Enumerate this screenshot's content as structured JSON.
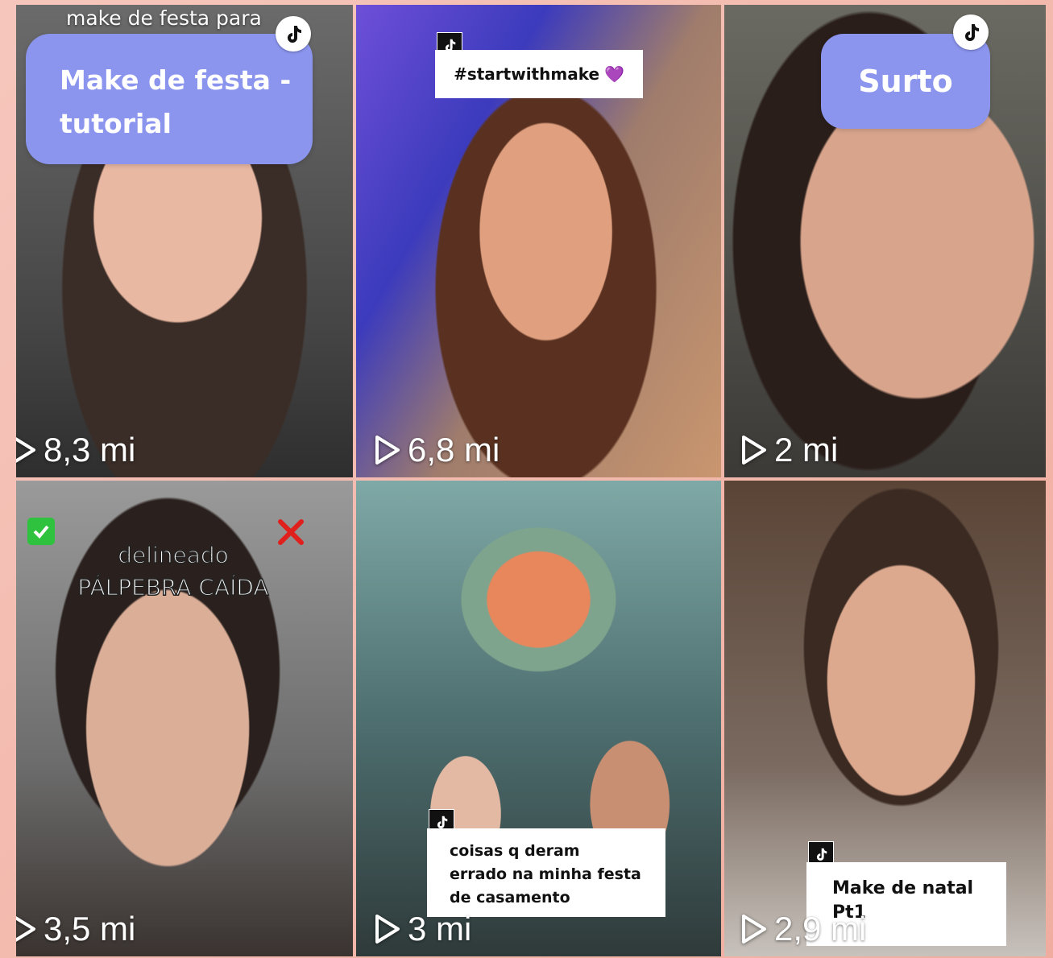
{
  "tiles": [
    {
      "top_caption": "make de festa para",
      "title_lines": [
        "Make de festa -",
        "tutorial"
      ],
      "views": "8,3 mi"
    },
    {
      "hashtag": "#startwithmake",
      "heart_emoji": "💜",
      "views": "6,8 mi"
    },
    {
      "title": "Surto",
      "views": "2 mi"
    },
    {
      "check_emoji": "✅",
      "cross_emoji": "❌",
      "title_lines": [
        "delineado",
        "PÁLPEBRA CAÍDA"
      ],
      "views": "3,5 mi"
    },
    {
      "caption_lines": [
        "coisas q deram",
        "errado na minha festa",
        "de casamento"
      ],
      "views": "3 mi"
    },
    {
      "caption_lines": [
        "Make de natal",
        "Pt1"
      ],
      "views": "2,9 mi"
    }
  ],
  "colors": {
    "background": "#f3b9ae",
    "pill": "#8b95ee"
  },
  "icons": [
    "tiktok-icon",
    "play-icon"
  ]
}
